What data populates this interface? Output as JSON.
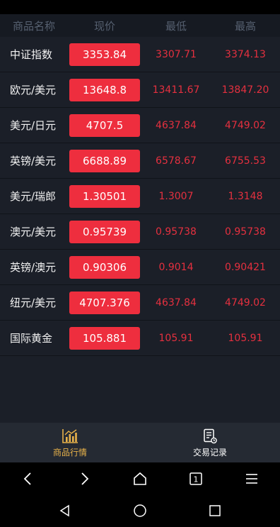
{
  "header": {
    "col_name": "商品名称",
    "col_price": "现价",
    "col_low": "最低",
    "col_high": "最高"
  },
  "rows": [
    {
      "name": "中证指数",
      "price": "3353.84",
      "low": "3307.71",
      "high": "3374.13"
    },
    {
      "name": "欧元/美元",
      "price": "13648.8",
      "low": "13411.67",
      "high": "13847.20"
    },
    {
      "name": "美元/日元",
      "price": "4707.5",
      "low": "4637.84",
      "high": "4749.02"
    },
    {
      "name": "英镑/美元",
      "price": "6688.89",
      "low": "6578.67",
      "high": "6755.53"
    },
    {
      "name": "美元/瑞郎",
      "price": "1.30501",
      "low": "1.3007",
      "high": "1.3148"
    },
    {
      "name": "澳元/美元",
      "price": "0.95739",
      "low": "0.95738",
      "high": "0.95738"
    },
    {
      "name": "英镑/澳元",
      "price": "0.90306",
      "low": "0.9014",
      "high": "0.90421"
    },
    {
      "name": "纽元/美元",
      "price": "4707.376",
      "low": "4637.84",
      "high": "4749.02"
    },
    {
      "name": "国际黄金",
      "price": "105.881",
      "low": "105.91",
      "high": "105.91"
    }
  ],
  "nav": {
    "market_label": "商品行情",
    "market_icon": "bar-chart-icon",
    "records_label": "交易记录",
    "records_icon": "document-icon"
  },
  "browser_nav": {
    "tab_count": "1"
  },
  "colors": {
    "accent": "#e8b24a",
    "price_bg": "#ee2e3e",
    "value_red": "#e5303f",
    "row_bg": "#1b1f28"
  }
}
